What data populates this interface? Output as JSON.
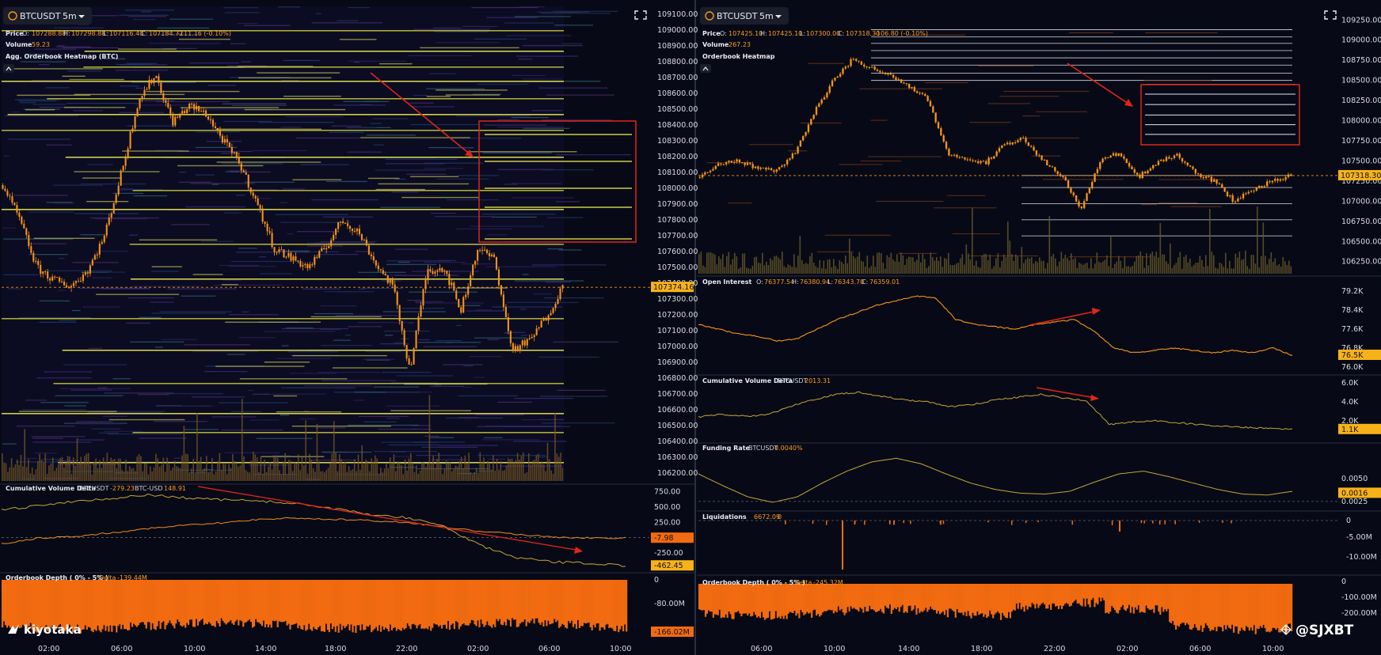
{
  "left": {
    "symbol": "BTCUSDT",
    "timeframe": "5m",
    "price_legend": {
      "label": "Price",
      "o_label": "O:",
      "o": "107288.88",
      "h_label": "H:",
      "h": "107298.88",
      "l_label": "L:",
      "l": "107116.40",
      "c_label": "C:",
      "c": "107184.72",
      "chg": "-111.16 (-0.10%)"
    },
    "volume_legend": {
      "label": "Volume",
      "value": "59.23"
    },
    "heatmap_label": "Agg. Orderbook Heatmap (BTC)",
    "price_axis": [
      "109100.00",
      "109000.00",
      "108900.00",
      "108800.00",
      "108700.00",
      "108600.00",
      "108500.00",
      "108400.00",
      "108300.00",
      "108200.00",
      "108100.00",
      "108000.00",
      "107900.00",
      "107800.00",
      "107700.00",
      "107600.00",
      "107500.00",
      "107400.00",
      "107300.00",
      "107200.00",
      "107100.00",
      "107000.00",
      "106900.00",
      "106800.00",
      "106700.00",
      "106600.00",
      "106500.00",
      "106400.00",
      "106300.00",
      "106200.00"
    ],
    "last_price": "107374.16",
    "cvd": {
      "label": "Cumulative Volume Delta",
      "s1_name": "BTCUSDT",
      "s1_value": "-279.23",
      "s2_name": "BTC-USD",
      "s2_value": "148.91",
      "axis": [
        "750.00",
        "500.00",
        "250.00",
        "-250.00"
      ],
      "tag1": "-7.98",
      "tag2": "-462.45"
    },
    "depth": {
      "label": "Orderbook Depth ( 0% - 5% )",
      "delta_label": "Delta",
      "delta": "-139.44M",
      "axis": [
        "0",
        "-80.00M"
      ],
      "tag": "-166.02M"
    },
    "time_axis": [
      "02:00",
      "06:00",
      "10:00",
      "14:00",
      "18:00",
      "22:00",
      "02:00",
      "06:00",
      "10:00"
    ],
    "brand": "kiyotaka"
  },
  "right": {
    "symbol": "BTCUSDT",
    "timeframe": "5m",
    "price_legend": {
      "label": "Price",
      "o_label": "O:",
      "o": "107425.10",
      "h_label": "H:",
      "h": "107425.10",
      "l_label": "L:",
      "l": "107300.00",
      "c_label": "C:",
      "c": "107318.30",
      "chg": "-106.80 (-0.10%)"
    },
    "volume_legend": {
      "label": "Volume",
      "value": "267.23"
    },
    "heatmap_label": "Orderbook Heatmap",
    "price_axis": [
      "109250.00",
      "109000.00",
      "108750.00",
      "108500.00",
      "108250.00",
      "108000.00",
      "107750.00",
      "107500.00",
      "107250.00",
      "107000.00",
      "106750.00",
      "106500.00",
      "106250.00"
    ],
    "last_price": "107318.30",
    "oi": {
      "label": "Open Interest",
      "o": "76377.54",
      "h": "76380.94",
      "l": "76343.70",
      "c": "76359.01",
      "axis": [
        "79.2K",
        "78.4K",
        "77.6K",
        "76.8K",
        "76.0K"
      ],
      "tag": "76.5K"
    },
    "cvd": {
      "label": "Cumulative Volume Delta",
      "s1_name": "BTCUSDT",
      "s1_value": "2013.31",
      "axis": [
        "6.0K",
        "4.0K",
        "2.0K"
      ],
      "tag": "1.1K"
    },
    "funding": {
      "label": "Funding Rate",
      "s1_name": "BTCUSDT",
      "s1_value": "0.0040%",
      "axis": [
        "0.0050",
        "0.0025"
      ],
      "tag": "0.0016"
    },
    "liq": {
      "label": "Liquidations",
      "value": "6672.09",
      "value2": "0",
      "axis": [
        "0",
        "-5.00M",
        "-10.00M"
      ]
    },
    "depth": {
      "label": "Orderbook Depth ( 0% - 5% )",
      "delta_label": "Delta",
      "delta": "-245.32M",
      "axis": [
        "0",
        "-100.00M",
        "-200.00M"
      ]
    },
    "time_axis": [
      "06:00",
      "10:00",
      "14:00",
      "18:00",
      "22:00",
      "02:00",
      "06:00",
      "10:00"
    ]
  },
  "watermark": "@SJXBT",
  "colors": {
    "background": "#070a16",
    "price_line": "#f7931a",
    "depth_fill": "#f26b10",
    "annotation": "#e0241a",
    "heat_hot": "#f5f250",
    "cvd_line": "#c8a43a"
  },
  "chart_data": [
    {
      "type": "line",
      "panel": "left-price",
      "x": [
        "02:00",
        "03:00",
        "04:00",
        "05:00",
        "06:00",
        "07:00",
        "08:00",
        "09:00",
        "10:00",
        "11:00",
        "12:00",
        "13:00",
        "14:00",
        "15:00",
        "16:00",
        "17:00",
        "18:00",
        "19:00",
        "20:00",
        "21:00",
        "22:00",
        "23:00",
        "00:00",
        "01:00",
        "02:00",
        "03:00",
        "04:00",
        "05:00",
        "06:00",
        "07:00",
        "08:00",
        "09:00",
        "10:00",
        "10:30"
      ],
      "values": [
        108020,
        107800,
        107500,
        107420,
        107380,
        107480,
        107700,
        108100,
        108560,
        108720,
        108420,
        108520,
        108470,
        108300,
        108150,
        107900,
        107620,
        107560,
        107500,
        107620,
        107800,
        107720,
        107520,
        107380,
        106850,
        107480,
        107500,
        107230,
        107620,
        107550,
        106980,
        107030,
        107180,
        107374
      ],
      "ylim": [
        106150,
        109150
      ]
    },
    {
      "type": "line",
      "panel": "left-cvd",
      "series": [
        {
          "name": "BTCUSDT",
          "values": [
            450,
            520,
            600,
            640,
            700,
            650,
            620,
            600,
            560,
            480,
            380,
            330,
            200,
            -120,
            -330,
            -400,
            -420,
            -462
          ]
        },
        {
          "name": "BTC-USD",
          "values": [
            -100,
            -10,
            20,
            80,
            150,
            200,
            240,
            300,
            320,
            300,
            280,
            250,
            180,
            100,
            60,
            10,
            -5,
            -8
          ]
        }
      ],
      "ylim": [
        -550,
        850
      ]
    },
    {
      "type": "line",
      "panel": "right-price",
      "x": [
        "04:00",
        "05:00",
        "06:00",
        "07:00",
        "08:00",
        "09:00",
        "10:00",
        "11:00",
        "12:00",
        "13:00",
        "14:00",
        "15:00",
        "16:00",
        "17:00",
        "18:00",
        "19:00",
        "20:00",
        "21:00",
        "22:00",
        "23:00",
        "00:00",
        "01:00",
        "02:00",
        "03:00",
        "04:00",
        "05:00",
        "06:00",
        "07:00",
        "08:00",
        "09:00",
        "10:00",
        "10:30"
      ],
      "values": [
        107300,
        107450,
        107500,
        107420,
        107380,
        107600,
        108100,
        108500,
        108760,
        108650,
        108580,
        108420,
        108250,
        107600,
        107520,
        107480,
        107700,
        107780,
        107500,
        107320,
        106900,
        107500,
        107600,
        107300,
        107480,
        107580,
        107350,
        107250,
        107000,
        107150,
        107250,
        107318
      ],
      "ylim": [
        106100,
        109400
      ]
    },
    {
      "type": "line",
      "panel": "right-oi",
      "values": [
        77.8,
        77.6,
        77.4,
        77.3,
        77.1,
        77.2,
        77.6,
        78.0,
        78.3,
        78.6,
        78.8,
        79.0,
        78.9,
        78.0,
        77.8,
        77.7,
        77.6,
        77.8,
        77.9,
        78.0,
        77.5,
        76.8,
        76.6,
        76.7,
        76.8,
        76.7,
        76.6,
        76.7,
        76.6,
        76.8,
        76.5
      ],
      "ylim": [
        75.8,
        79.4
      ]
    },
    {
      "type": "line",
      "panel": "right-cvd",
      "values": [
        2400,
        2700,
        2500,
        2600,
        3500,
        4200,
        4800,
        5000,
        4600,
        4200,
        4000,
        3500,
        3700,
        4200,
        4500,
        4800,
        4400,
        4100,
        1600,
        1900,
        2000,
        1800,
        1600,
        1400,
        1300,
        1200,
        1100
      ],
      "ylim": [
        0,
        6500
      ]
    },
    {
      "type": "line",
      "panel": "right-funding",
      "values": [
        0.0055,
        0.0042,
        0.003,
        0.0024,
        0.003,
        0.0045,
        0.0058,
        0.0068,
        0.0072,
        0.0066,
        0.0055,
        0.0045,
        0.0038,
        0.0034,
        0.0033,
        0.0036,
        0.0046,
        0.0055,
        0.0058,
        0.0052,
        0.0045,
        0.0038,
        0.0033,
        0.0032,
        0.0036
      ],
      "ylim": [
        0.0018,
        0.008
      ]
    }
  ]
}
